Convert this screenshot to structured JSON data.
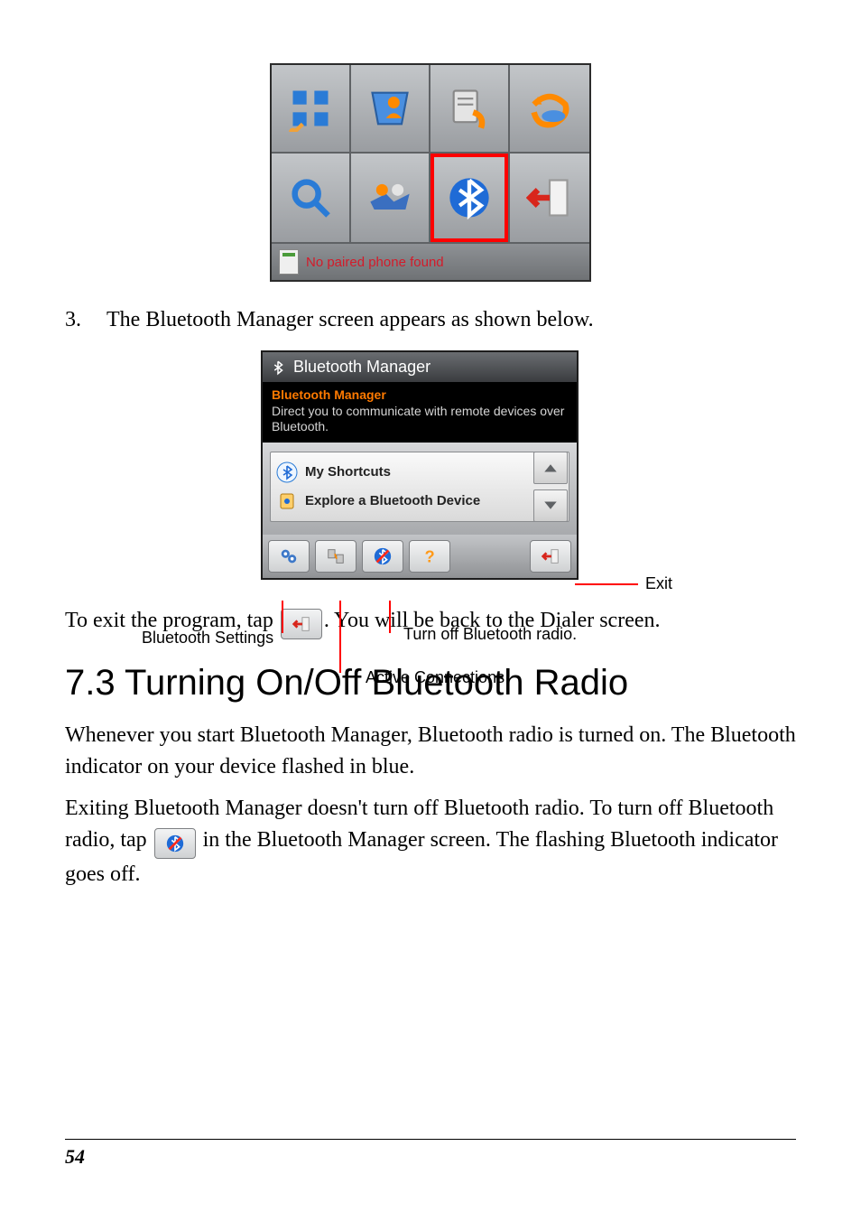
{
  "step3": {
    "num": "3.",
    "text": "The Bluetooth Manager screen appears as shown below."
  },
  "shot1": {
    "icons": [
      "dialer-keypad-icon",
      "contacts-icon",
      "call-log-icon",
      "redial-icon",
      "search-icon",
      "handshake-icon",
      "bluetooth-icon",
      "exit-icon"
    ],
    "highlight_index": 6,
    "status": "No paired phone found"
  },
  "bm": {
    "title": "Bluetooth Manager",
    "desc_head": "Bluetooth Manager",
    "desc_text": "Direct you to communicate with remote devices over Bluetooth.",
    "rows": [
      {
        "icon": "bluetooth-shortcut-icon",
        "label": "My Shortcuts"
      },
      {
        "icon": "explore-device-icon",
        "label": "Explore a Bluetooth Device"
      }
    ],
    "toolbar": [
      {
        "name": "bluetooth-settings-button",
        "icon": "gear-pair-icon"
      },
      {
        "name": "active-connections-button",
        "icon": "connections-icon"
      },
      {
        "name": "bluetooth-radio-button",
        "icon": "bluetooth-off-icon"
      },
      {
        "name": "help-button",
        "icon": "help-icon"
      },
      {
        "name": "exit-button",
        "icon": "back-icon"
      }
    ]
  },
  "callouts": {
    "exit": "Exit",
    "settings": "Bluetooth Settings",
    "connections": "Active Connections",
    "radio_off": "Turn off Bluetooth radio."
  },
  "exit_para_1": "To exit the program, tap ",
  "exit_para_2": ". You will be back to the Dialer screen.",
  "section": "7.3   Turning On/Off Bluetooth Radio",
  "p1": "Whenever you start Bluetooth Manager, Bluetooth radio is turned on. The Bluetooth indicator on your device flashed in blue.",
  "p2a": "Exiting Bluetooth Manager doesn't turn off Bluetooth radio. To turn off Bluetooth radio, tap ",
  "p2b": " in the Bluetooth Manager screen. The flashing Bluetooth indicator goes off.",
  "page_number": "54"
}
